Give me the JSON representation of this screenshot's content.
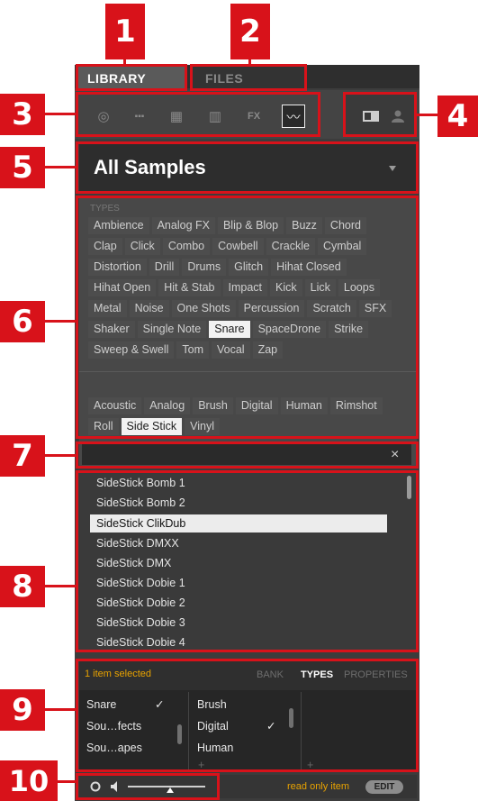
{
  "callouts": [
    "1",
    "2",
    "3",
    "4",
    "5",
    "6",
    "7",
    "8",
    "9",
    "10"
  ],
  "tabs": {
    "library": "LIBRARY",
    "files": "FILES"
  },
  "content_icons": [
    "project-icon",
    "group-icon",
    "sound-icon",
    "instrument-icon",
    "fx-icon",
    "sample-icon"
  ],
  "content_icon_glyphs": [
    "◎",
    "▪▪▪",
    "▦",
    "▥",
    "FX",
    "〰"
  ],
  "file_type_icons": [
    "factory-icon",
    "user-icon"
  ],
  "product": {
    "selected": "All Samples"
  },
  "types": {
    "label": "TYPES",
    "tags": [
      "Ambience",
      "Analog FX",
      "Blip & Blop",
      "Buzz",
      "Chord",
      "Clap",
      "Click",
      "Combo",
      "Cowbell",
      "Crackle",
      "Cymbal",
      "Distortion",
      "Drill",
      "Drums",
      "Glitch",
      "Hihat Closed",
      "Hihat Open",
      "Hit & Stab",
      "Impact",
      "Kick",
      "Lick",
      "Loops",
      "Metal",
      "Noise",
      "One Shots",
      "Percussion",
      "Scratch",
      "SFX",
      "Shaker",
      "Single Note",
      "Snare",
      "SpaceDrone",
      "Strike",
      "Sweep & Swell",
      "Tom",
      "Vocal",
      "Zap"
    ],
    "selected": "Snare"
  },
  "subtypes": {
    "tags": [
      "Acoustic",
      "Analog",
      "Brush",
      "Digital",
      "Human",
      "Rimshot",
      "Roll",
      "Side Stick",
      "Vinyl"
    ],
    "selected": "Side Stick"
  },
  "search": {
    "value": "",
    "clear": "×"
  },
  "results": {
    "items": [
      "SideStick Bomb 1",
      "SideStick Bomb 2",
      "SideStick ClikDub",
      "SideStick DMXX",
      "SideStick DMX",
      "SideStick Dobie 1",
      "SideStick Dobie 2",
      "SideStick Dobie 3",
      "SideStick Dobie 4"
    ],
    "selected": "SideStick ClikDub"
  },
  "attributes": {
    "status": "1 item selected",
    "tabs": [
      "BANK",
      "TYPES",
      "PROPERTIES"
    ],
    "active_tab": "TYPES",
    "col1": [
      "Snare",
      "Sou…fects",
      "Sou…apes"
    ],
    "col1_checked": "Snare",
    "col2": [
      "Brush",
      "Digital",
      "Human"
    ],
    "col2_checked": "Digital",
    "plus": "+",
    "check": "✓"
  },
  "footer": {
    "readonly": "read only item",
    "edit": "EDIT",
    "prehear_level": 0.55
  },
  "colors": {
    "callout": "#d8121a",
    "panel": "#3c3c3c",
    "accent": "#e8a200"
  }
}
